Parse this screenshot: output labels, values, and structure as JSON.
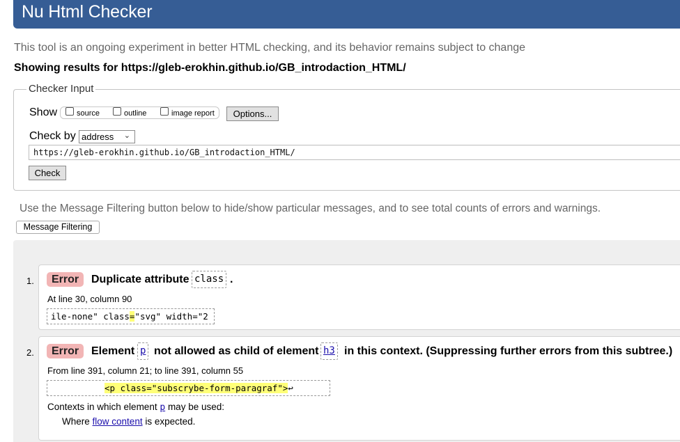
{
  "header": {
    "title": "Nu Html Checker"
  },
  "intro": "This tool is an ongoing experiment in better HTML checking, and its behavior remains subject to change",
  "showing": "Showing results for https://gleb-erokhin.github.io/GB_introdaction_HTML/",
  "checker": {
    "legend": "Checker Input",
    "show_label": "Show",
    "options": [
      "source",
      "outline",
      "image report"
    ],
    "options_button": "Options...",
    "checkby_label": "Check by",
    "checkby_value": "address",
    "caret": "⌄",
    "url_value": "https://gleb-erokhin.github.io/GB_introdaction_HTML/",
    "check_button": "Check"
  },
  "filter": {
    "help": "Use the Message Filtering button below to hide/show particular messages, and to see total counts of errors and warnings.",
    "button": "Message Filtering"
  },
  "messages": [
    {
      "num": "1.",
      "type": "Error",
      "text_a": "Duplicate attribute",
      "code_a": "class",
      "text_b": ".",
      "location": "At line 30, column 90",
      "extract_pre": "ile-none\" class",
      "extract_hl": "=",
      "extract_post": "\"svg\" width=\"2"
    },
    {
      "num": "2.",
      "type": "Error",
      "text_a": "Element",
      "code_a": "p",
      "text_b": "not allowed as child of element",
      "code_b": "h3",
      "text_c": "in this context. (Suppressing further errors from this subtree.)",
      "location": "From line 391, column 21; to line 391, column 55",
      "extract_hl": "<p class=\"subscrybe-form-paragraf\">",
      "extract_post": "↩",
      "contexts_pre": "Contexts in which element",
      "contexts_code": "p",
      "contexts_post": "may be used:",
      "where_pre": "Where",
      "where_link": "flow content",
      "where_post": "is expected."
    }
  ]
}
